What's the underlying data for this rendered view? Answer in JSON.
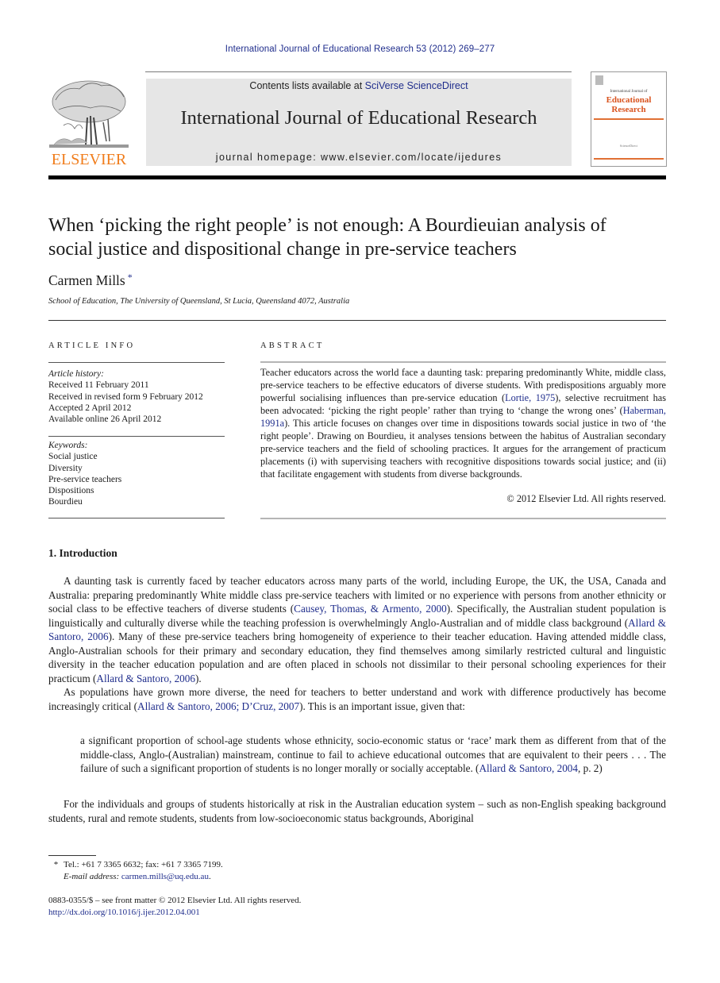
{
  "header": {
    "running_head": "International Journal of Educational Research 53 (2012) 269–277",
    "publisher_wordmark": "ELSEVIER",
    "contents_prefix": "Contents lists available at ",
    "contents_link": "SciVerse ScienceDirect",
    "journal_title": "International Journal of Educational Research",
    "homepage_prefix": "journal homepage: ",
    "homepage_url": "www.elsevier.com/locate/ijedures",
    "cover": {
      "small_title": "International Journal of",
      "big_title_line1": "Educational",
      "big_title_line2": "Research",
      "bottom_text": "ScienceDirect"
    }
  },
  "article": {
    "title_line1": "When ‘picking the right people’ is not enough: A Bourdieuian analysis of",
    "title_line2": "social justice and dispositional change in pre-service teachers",
    "author": "Carmen Mills",
    "author_mark": "*",
    "affiliation": "School of Education, The University of Queensland, St Lucia, Queensland 4072, Australia"
  },
  "article_info": {
    "label": "ARTICLE INFO",
    "history_label": "Article history:",
    "history": [
      "Received 11 February 2011",
      "Received in revised form 9 February 2012",
      "Accepted 2 April 2012",
      "Available online 26 April 2012"
    ],
    "keywords_label": "Keywords:",
    "keywords": [
      "Social justice",
      "Diversity",
      "Pre-service teachers",
      "Dispositions",
      "Bourdieu"
    ]
  },
  "abstract": {
    "label": "ABSTRACT",
    "part1": "Teacher educators across the world face a daunting task: preparing predominantly White, middle class, pre-service teachers to be effective educators of diverse students. With predispositions arguably more powerful socialising influences than pre-service education (",
    "cite1": "Lortie, 1975",
    "part2": "), selective recruitment has been advocated: ‘picking the right people’ rather than trying to ‘change the wrong ones’ (",
    "cite2": "Haberman, 1991a",
    "part3": "). This article focuses on changes over time in dispositions towards social justice in two of ‘the right people’. Drawing on Bourdieu, it analyses tensions between the habitus of Australian secondary pre-service teachers and the field of schooling practices. It argues for the arrangement of practicum placements (i) with supervising teachers with recognitive dispositions towards social justice; and (ii) that facilitate engagement with students from diverse backgrounds.",
    "copyright": "© 2012 Elsevier Ltd. All rights reserved."
  },
  "introduction": {
    "heading": "1.  Introduction",
    "p1_a": "A daunting task is currently faced by teacher educators across many parts of the world, including Europe, the UK, the USA, Canada and Australia: preparing predominantly White middle class pre-service teachers with limited or no experience with persons from another ethnicity or social class to be effective teachers of diverse students (",
    "p1_cite1": "Causey, Thomas, & Armento, 2000",
    "p1_b": "). Specifically, the Australian student population is linguistically and culturally diverse while the teaching profession is overwhelmingly Anglo-Australian and of middle class background (",
    "p1_cite2": "Allard & Santoro, 2006",
    "p1_c": "). Many of these pre-service teachers bring homogeneity of experience to their teacher education. Having attended middle class, Anglo-Australian schools for their primary and secondary education, they find themselves among similarly restricted cultural and linguistic diversity in the teacher education population and are often placed in schools not dissimilar to their personal schooling experiences for their practicum (",
    "p1_cite3": "Allard & Santoro, 2006",
    "p1_d": ").",
    "p2_a": "As populations have grown more diverse, the need for teachers to better understand and work with difference productively has become increasingly critical (",
    "p2_cite": "Allard & Santoro, 2006; D’Cruz, 2007",
    "p2_b": "). This is an important issue, given that:",
    "quote_a": "a significant proportion of school-age students whose ethnicity, socio-economic status or ‘race’ mark them as different from that of the middle-class, Anglo-(Australian) mainstream, continue to fail to achieve educational outcomes that are equivalent to their peers . . . The failure of such a significant proportion of students is no longer morally or socially acceptable. (",
    "quote_cite": "Allard & Santoro, 2004",
    "quote_b": ", p. 2)",
    "p3": "For the individuals and groups of students historically at risk in the Australian education system – such as non-English speaking background students, rural and remote students, students from low-socioeconomic status backgrounds, Aboriginal"
  },
  "footnote": {
    "mark": "*",
    "contact": "Tel.: +61 7 3365 6632; fax: +61 7 3365 7199.",
    "email_label": "E-mail address: ",
    "email": "carmen.mills@uq.edu.au",
    "email_end": "."
  },
  "bottom": {
    "issn_line": "0883-0355/$ – see front matter © 2012 Elsevier Ltd. All rights reserved.",
    "doi": "http://dx.doi.org/10.1016/j.ijer.2012.04.001"
  },
  "colors": {
    "link": "#1f2d8c",
    "elsevier_orange": "#f07d1c",
    "banner_bg": "#e6e6e6"
  }
}
